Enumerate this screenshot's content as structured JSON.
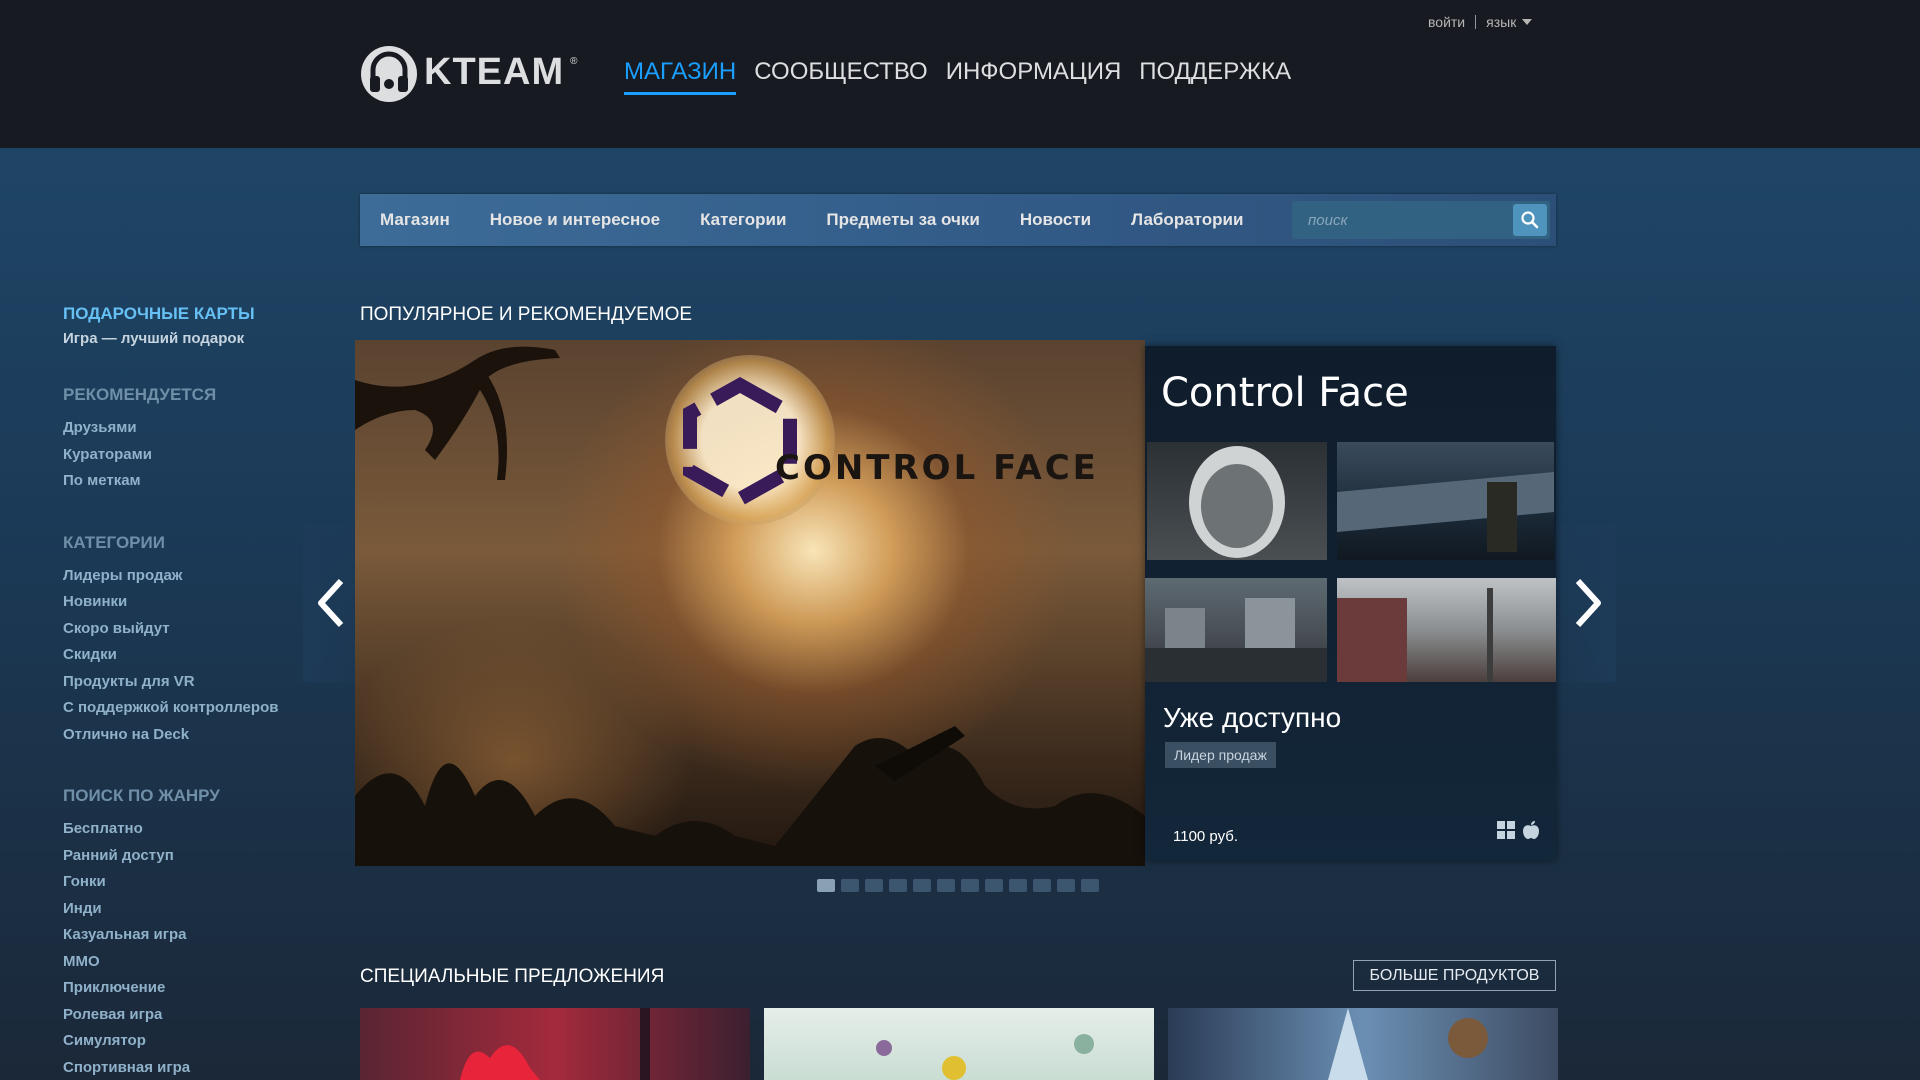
{
  "header": {
    "login": "войти",
    "language": "язык",
    "logo_text": "KTEAM",
    "logo_reg": "®",
    "nav": [
      "МАГАЗИН",
      "СООБЩЕСТВО",
      "ИНФОРМАЦИЯ",
      "ПОДДЕРЖКА"
    ],
    "active_nav": "МАГАЗИН"
  },
  "store_nav": {
    "tabs": [
      "Магазин",
      "Новое и интересное",
      "Категории",
      "Предметы за очки",
      "Новости",
      "Лаборатории"
    ],
    "search_placeholder": "поиск"
  },
  "sidebar": {
    "gift_title": "ПОДАРОЧНЫЕ КАРТЫ",
    "gift_subtitle": "Игра — лучший подарок",
    "recommended": {
      "heading": "РЕКОМЕНДУЕТСЯ",
      "links": [
        "Друзьями",
        "Кураторами",
        "По меткам"
      ]
    },
    "categories": {
      "heading": "КАТЕГОРИИ",
      "links": [
        "Лидеры продаж",
        "Новинки",
        "Скоро выйдут",
        "Скидки",
        "Продукты для VR",
        "С поддержкой контроллеров",
        "Отлично на Deck"
      ]
    },
    "genres": {
      "heading": "ПОИСК ПО ЖАНРУ",
      "links": [
        "Бесплатно",
        "Ранний доступ",
        "Гонки",
        "Инди",
        "Казуальная игра",
        "MMO",
        "Приключение",
        "Ролевая игра",
        "Симулятор",
        "Спортивная игра"
      ]
    }
  },
  "featured": {
    "section_title": "ПОПУЛЯРНОЕ И РЕКОМЕНДУЕМОЕ",
    "capsule_logo": "CONTROL FACE",
    "title": "Control Face",
    "status": "Уже доступно",
    "tag": "Лидер продаж",
    "price": "1100 руб.",
    "platform_icons": [
      "windows-icon",
      "apple-icon"
    ],
    "dots_total": 12,
    "active_dot": 0
  },
  "specials": {
    "section_title": "СПЕЦИАЛЬНЫЕ ПРЕДЛОЖЕНИЯ",
    "more_button": "БОЛЬШЕ ПРОДУКТОВ"
  },
  "colors": {
    "accent": "#1a9fff",
    "link": "#66c0f4",
    "topbar": "#171a21",
    "background": "#1b2838"
  }
}
